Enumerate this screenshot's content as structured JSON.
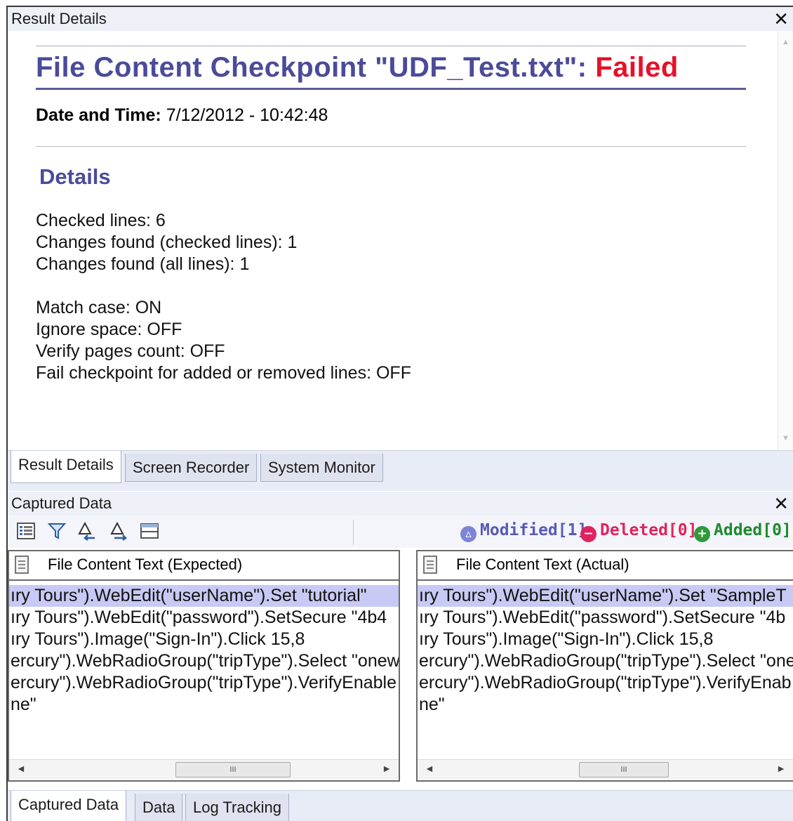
{
  "result_pane": {
    "title": "Result Details",
    "close": "✕",
    "report": {
      "title_prefix": "File Content Checkpoint \"UDF_Test.txt\": ",
      "status": "Failed",
      "datetime_label": "Date and Time:",
      "datetime_value": " 7/12/2012 - 10:42:48",
      "details_heading": "Details",
      "lines": [
        "Checked lines: 6",
        "Changes found (checked lines): 1",
        "Changes found (all lines): 1",
        "Match case: ON",
        "Ignore space: OFF",
        "Verify pages count: OFF",
        "Fail checkpoint for added or removed lines: OFF"
      ]
    },
    "tabs": [
      "Result Details",
      "Screen Recorder",
      "System Monitor"
    ],
    "active_tab": "Result Details"
  },
  "captured_pane": {
    "title": "Captured Data",
    "close": "✕",
    "toolbar_icons": [
      "properties-icon",
      "filter-icon",
      "previous-change-icon",
      "next-change-icon",
      "split-view-icon"
    ],
    "legend": {
      "modified": "Modified[1]",
      "deleted": "Deleted[0]",
      "added": "Added[0]"
    },
    "expected": {
      "header": "File Content Text (Expected)",
      "lines": [
        "ıry Tours\").WebEdit(\"userName\").Set \"tutorial\"",
        "ıry Tours\").WebEdit(\"password\").SetSecure \"4b4",
        "ıry Tours\").Image(\"Sign-In\").Click 15,8",
        "ercury\").WebRadioGroup(\"tripType\").Select \"onew",
        "ercury\").WebRadioGroup(\"tripType\").VerifyEnable",
        "ne\""
      ]
    },
    "actual": {
      "header": "File Content Text (Actual)",
      "lines": [
        "ıry Tours\").WebEdit(\"userName\").Set \"SampleT",
        "ıry Tours\").WebEdit(\"password\").SetSecure \"4b",
        "ıry Tours\").Image(\"Sign-In\").Click 15,8",
        "ercury\").WebRadioGroup(\"tripType\").Select \"one",
        "ercury\").WebRadioGroup(\"tripType\").VerifyEnab",
        "ne\""
      ]
    },
    "scroll_thumb": "III",
    "tabs": [
      "Captured Data",
      "Data",
      "Log Tracking"
    ],
    "active_tab": "Captured Data"
  },
  "colors": {
    "title": "#4b4b9a",
    "failed": "#e8102a",
    "modified": "#5a5ab8",
    "deleted": "#e0245e",
    "added": "#1e8a2e",
    "highlight": "#c9c9f5"
  }
}
